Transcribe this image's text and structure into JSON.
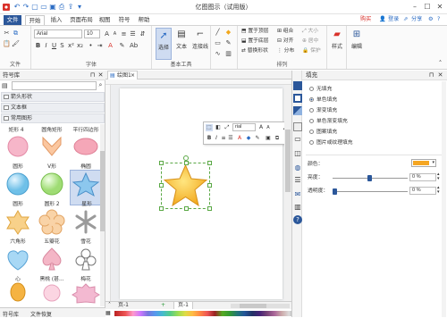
{
  "window": {
    "title": "亿图图示（试用版）"
  },
  "tabs": [
    "文件",
    "开始",
    "插入",
    "页面布局",
    "视图",
    "符号",
    "帮助"
  ],
  "user": {
    "buy": "购买",
    "login": "登录",
    "share": "分享"
  },
  "ribbon": {
    "file_group": "文件",
    "font_group": "字体",
    "tools_group": "基本工具",
    "arrange_group": "排列",
    "font_name": "Arial",
    "font_size": "10",
    "select": "选择",
    "text": "文本",
    "connector": "连接线",
    "bring_front": "置于顶层",
    "send_back": "置于底层",
    "replace_shape": "替换形状",
    "group": "组合",
    "align": "对齐",
    "distribute": "分布",
    "size": "大小",
    "center": "居中",
    "protect": "保护",
    "style": "样式",
    "edit": "编辑"
  },
  "library": {
    "title": "符号库",
    "search_placeholder": "",
    "categories": [
      "箭头形状",
      "文本框",
      "常用图形"
    ],
    "shapes": [
      {
        "label": "矩形 4"
      },
      {
        "label": "圆角矩形"
      },
      {
        "label": "平行四边形"
      },
      {
        "label": "圆形"
      },
      {
        "label": "V形"
      },
      {
        "label": "椭圆"
      },
      {
        "label": "圆形"
      },
      {
        "label": "圆形 2"
      },
      {
        "label": "星形"
      },
      {
        "label": "六角形"
      },
      {
        "label": "五瓣花"
      },
      {
        "label": "雪花"
      },
      {
        "label": "心"
      },
      {
        "label": "黑桃 (甚..."
      },
      {
        "label": "梅花"
      }
    ],
    "bottom_tabs": [
      "符号库",
      "文件恢复"
    ]
  },
  "canvas": {
    "doc_tab": "绘图1",
    "page_label": "页-1",
    "page_tab": "页-1",
    "font_name": "rial"
  },
  "fill": {
    "title": "填充",
    "options": [
      "无填充",
      "单色填充",
      "渐变填充",
      "单色渐变填充",
      "图案填充",
      "图片或纹理填充"
    ],
    "selected_index": 1,
    "color_label": "颜色：",
    "color": "#f5a623",
    "brightness_label": "亮度：",
    "brightness_value": "0 %",
    "transparency_label": "透明度：",
    "transparency_value": "0 %"
  },
  "colors": {
    "accent": "#2b579a",
    "star_light": "#ffe680",
    "star_dark": "#f2a71c"
  }
}
